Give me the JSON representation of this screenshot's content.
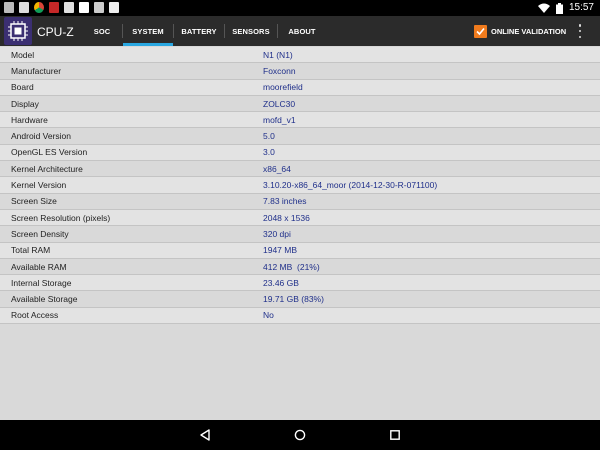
{
  "statusbar": {
    "time": "15:57",
    "icons": [
      "gallery-icon",
      "media-icon",
      "chrome-icon",
      "app-icon",
      "app-icon",
      "calendar-icon",
      "app-icon",
      "muted-icon"
    ],
    "wifi_icon": "wifi-icon",
    "battery_icon": "battery-icon"
  },
  "appbar": {
    "title": "CPU-Z",
    "tabs": [
      {
        "label": "SOC"
      },
      {
        "label": "SYSTEM"
      },
      {
        "label": "BATTERY"
      },
      {
        "label": "SENSORS"
      },
      {
        "label": "ABOUT"
      }
    ],
    "active_tab": "SYSTEM",
    "validation_label": "ONLINE VALIDATION",
    "accent_color": "#29a7e1",
    "validation_color": "#f07b1d"
  },
  "system": [
    {
      "label": "Model",
      "value": "N1 (N1)"
    },
    {
      "label": "Manufacturer",
      "value": "Foxconn"
    },
    {
      "label": "Board",
      "value": "moorefield"
    },
    {
      "label": "Display",
      "value": "ZOLC30"
    },
    {
      "label": "Hardware",
      "value": "mofd_v1"
    },
    {
      "label": "Android Version",
      "value": "5.0"
    },
    {
      "label": "OpenGL ES Version",
      "value": "3.0"
    },
    {
      "label": "Kernel Architecture",
      "value": "x86_64"
    },
    {
      "label": "Kernel Version",
      "value": "3.10.20-x86_64_moor (2014-12-30-R-071100)"
    },
    {
      "label": "Screen Size",
      "value": "7.83 inches"
    },
    {
      "label": "Screen Resolution (pixels)",
      "value": "2048 x 1536"
    },
    {
      "label": "Screen Density",
      "value": "320 dpi"
    },
    {
      "label": "Total RAM",
      "value": "1947 MB"
    },
    {
      "label": "Available RAM",
      "value": "412 MB  (21%)"
    },
    {
      "label": "Internal Storage",
      "value": "23.46 GB"
    },
    {
      "label": "Available Storage",
      "value": "19.71 GB (83%)"
    },
    {
      "label": "Root Access",
      "value": "No"
    }
  ],
  "navbar": {
    "back_icon": "back-icon",
    "home_icon": "home-icon",
    "recents_icon": "recents-icon"
  }
}
